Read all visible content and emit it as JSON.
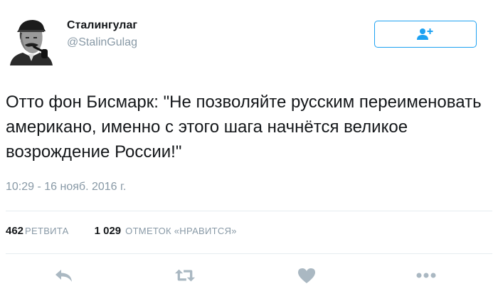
{
  "author": {
    "name": "Сталингулаг",
    "handle": "@StalinGulag",
    "avatar_icon": "stalin-portrait-avatar"
  },
  "follow_button": {
    "icon": "add-user-icon",
    "accent_color": "#1da1f2"
  },
  "tweet": {
    "text": "Отто фон Бисмарк: \"Не позволяйте русским переименовать американо, именно с этого шага начнётся великое возрождение России!\"",
    "timestamp": "10:29 - 16 нояб. 2016 г."
  },
  "stats": {
    "retweets_count": "462",
    "retweets_label": "РЕТВИТА",
    "likes_count": "1 029",
    "likes_label": "ОТМЕТОК «НРАВИТСЯ»"
  },
  "actions": [
    {
      "icon": "reply-icon"
    },
    {
      "icon": "retweet-icon"
    },
    {
      "icon": "heart-icon"
    },
    {
      "icon": "more-icon"
    }
  ],
  "colors": {
    "text": "#14171a",
    "secondary": "#8899a6",
    "action_icon": "#aab8c2",
    "divider": "#e6ecf0"
  }
}
